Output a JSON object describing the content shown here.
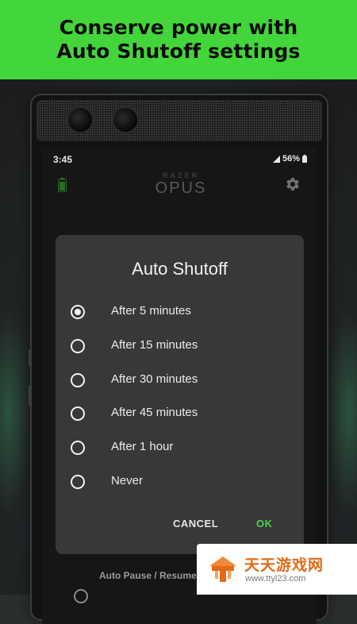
{
  "banner": {
    "line1": "Conserve power with",
    "line2": "Auto Shutoff settings"
  },
  "status_bar": {
    "time": "3:45",
    "battery": "56%"
  },
  "app": {
    "logo_top": "RAZER",
    "logo_main": "OPUS",
    "background_label": "Auto Pause / Resume"
  },
  "dialog": {
    "title": "Auto Shutoff",
    "options": [
      {
        "label": "After 5 minutes",
        "selected": true
      },
      {
        "label": "After 15 minutes",
        "selected": false
      },
      {
        "label": "After 30 minutes",
        "selected": false
      },
      {
        "label": "After 45 minutes",
        "selected": false
      },
      {
        "label": "After 1 hour",
        "selected": false
      },
      {
        "label": "Never",
        "selected": false
      }
    ],
    "cancel_label": "CANCEL",
    "ok_label": "OK"
  },
  "watermark": {
    "text": "天天游戏网",
    "url": "www.ttyl23.com"
  },
  "colors": {
    "banner": "#43d63a",
    "accent": "#4fd447",
    "dialog_bg": "#373839",
    "watermark": "#e36b15"
  }
}
